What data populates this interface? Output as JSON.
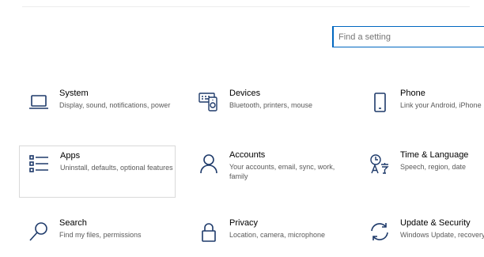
{
  "search": {
    "placeholder": "Find a setting"
  },
  "tiles": [
    {
      "icon": "laptop-icon",
      "title": "System",
      "desc": "Display, sound, notifications, power"
    },
    {
      "icon": "devices-icon",
      "title": "Devices",
      "desc": "Bluetooth, printers, mouse"
    },
    {
      "icon": "phone-icon",
      "title": "Phone",
      "desc": "Link your Android, iPhone"
    },
    {
      "icon": "apps-icon",
      "title": "Apps",
      "desc": "Uninstall, defaults, optional features"
    },
    {
      "icon": "person-icon",
      "title": "Accounts",
      "desc": "Your accounts, email, sync, work, family"
    },
    {
      "icon": "language-icon",
      "title": "Time & Language",
      "desc": "Speech, region, date"
    },
    {
      "icon": "search-icon",
      "title": "Search",
      "desc": "Find my files, permissions"
    },
    {
      "icon": "lock-icon",
      "title": "Privacy",
      "desc": "Location, camera, microphone"
    },
    {
      "icon": "sync-icon",
      "title": "Update & Security",
      "desc": "Windows Update, recovery, backup"
    }
  ],
  "colors": {
    "accent": "#0067c0",
    "icon": "#1e3a6a",
    "desc_text": "#5a5a5a",
    "selected_border": "#d9d9d9"
  }
}
